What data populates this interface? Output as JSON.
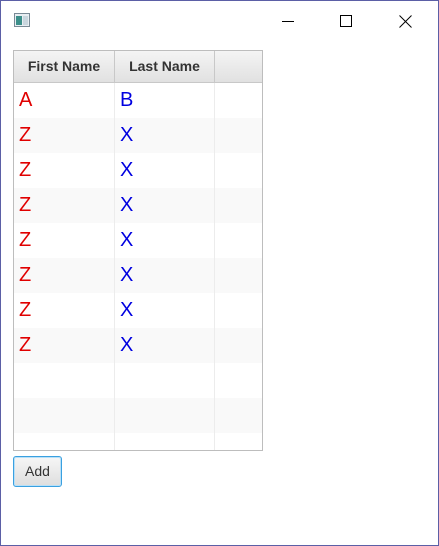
{
  "window": {
    "icon": "app-icon",
    "controls": {
      "minimize_icon": "minimize-icon",
      "maximize_icon": "maximize-icon",
      "close_icon": "close-icon"
    }
  },
  "table": {
    "columns": [
      "First Name",
      "Last Name",
      ""
    ],
    "rows": [
      {
        "first": "A",
        "last": "B"
      },
      {
        "first": "Z",
        "last": "X"
      },
      {
        "first": "Z",
        "last": "X"
      },
      {
        "first": "Z",
        "last": "X"
      },
      {
        "first": "Z",
        "last": "X"
      },
      {
        "first": "Z",
        "last": "X"
      },
      {
        "first": "Z",
        "last": "X"
      },
      {
        "first": "Z",
        "last": "X"
      },
      {
        "first": "",
        "last": ""
      },
      {
        "first": "",
        "last": ""
      },
      {
        "first": "",
        "last": ""
      }
    ],
    "colors": {
      "first_name_text": "#e00000",
      "last_name_text": "#0000e0"
    }
  },
  "add_button": {
    "label": "Add"
  }
}
